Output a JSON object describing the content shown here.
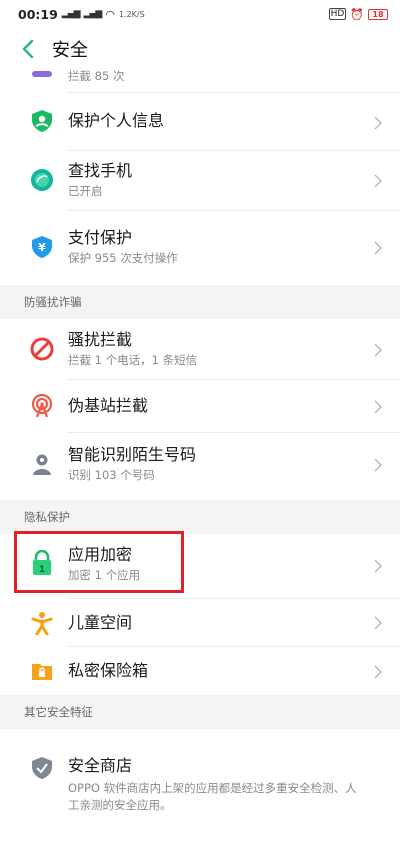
{
  "status_bar": {
    "time": "00:19",
    "signal1": "4G",
    "signal2": "4G",
    "speed": "1.2K/S",
    "hd": "HD",
    "battery": "18"
  },
  "header": {
    "title": "安全"
  },
  "top_partial": {
    "sub": "拦截 85 次"
  },
  "rows_group1": [
    {
      "title": "保护个人信息",
      "sub": "",
      "icon": "user-shield-icon"
    },
    {
      "title": "查找手机",
      "sub": "已开启",
      "icon": "find-phone-icon"
    },
    {
      "title": "支付保护",
      "sub": "保护 955 次支付操作",
      "icon": "payment-shield-icon"
    }
  ],
  "section_antifraud": {
    "label": "防骚扰诈骗"
  },
  "rows_group2": [
    {
      "title": "骚扰拦截",
      "sub": "拦截 1 个电话，1 条短信",
      "icon": "block-icon"
    },
    {
      "title": "伪基站拦截",
      "sub": "",
      "icon": "fake-station-icon"
    },
    {
      "title": "智能识别陌生号码",
      "sub": "识别 103 个号码",
      "icon": "caller-id-icon"
    }
  ],
  "section_privacy": {
    "label": "隐私保护"
  },
  "rows_group3": [
    {
      "title": "应用加密",
      "sub": "加密 1 个应用",
      "icon": "lock-icon"
    },
    {
      "title": "儿童空间",
      "sub": "",
      "icon": "child-icon"
    },
    {
      "title": "私密保险箱",
      "sub": "",
      "icon": "safe-icon"
    }
  ],
  "section_other": {
    "label": "其它安全特征"
  },
  "store": {
    "title": "安全商店",
    "desc": "OPPO 软件商店内上架的应用都是经过多重安全检测、人工亲测的安全应用。"
  },
  "colors": {
    "accent": "#1db88e",
    "highlight_box": "#e0202a",
    "section_bg": "#f4f4f4"
  }
}
